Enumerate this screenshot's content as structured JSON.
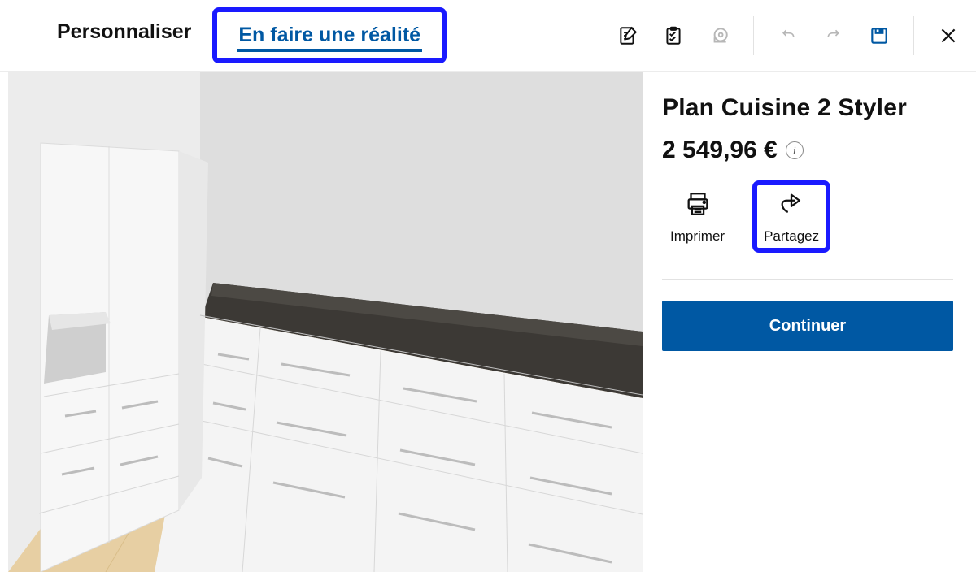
{
  "tabs": {
    "personalize": "Personnaliser",
    "realize": "En faire une réalité"
  },
  "side": {
    "title": "Plan Cuisine 2 Styler",
    "price": "2 549,96 €",
    "print_label": "Imprimer",
    "share_label": "Partagez",
    "continue_label": "Continuer"
  },
  "colors": {
    "accent": "#0058a3",
    "highlight": "#1a1aff"
  }
}
